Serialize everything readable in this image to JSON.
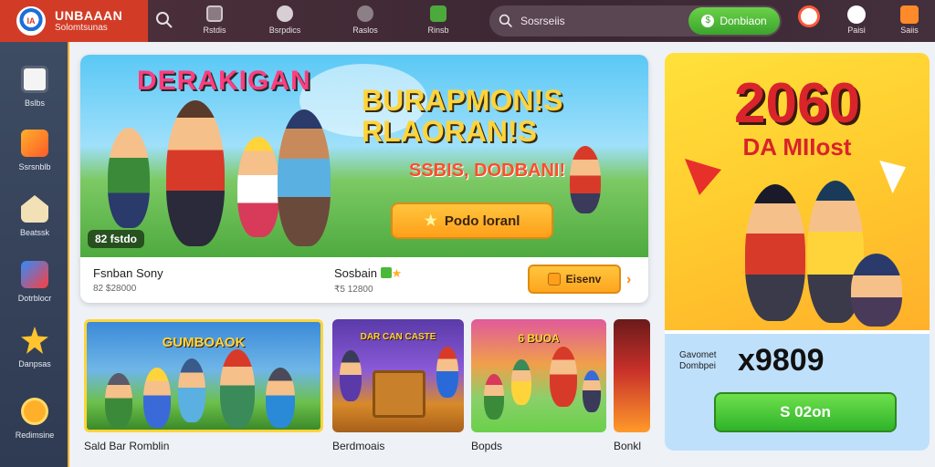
{
  "brand": {
    "logo_text": "IA",
    "title": "UNBAAAN",
    "subtitle": "Solomtsunas"
  },
  "topnav": [
    {
      "label": "Rstdis",
      "color": "#8a7a82"
    },
    {
      "label": "Bsrpdics",
      "color": "#d7cfd3"
    },
    {
      "label": "Raslos",
      "color": "#8d7f86"
    },
    {
      "label": "Rinsb",
      "color": "#4caa3c"
    }
  ],
  "search": {
    "placeholder": "Sosrseiis",
    "button_label": "Donbiaon"
  },
  "top_right": [
    {
      "label": "",
      "color": "#ff5a3c"
    },
    {
      "label": "Paisi",
      "color": "#ffffff"
    },
    {
      "label": "Saiis",
      "color": "#ff8a2a"
    }
  ],
  "sidebar": [
    {
      "label": "Bslbs",
      "color": "#f4f4f4"
    },
    {
      "label": "Ssrsnblb",
      "color": "#ff7a2a"
    },
    {
      "label": "Beatssk",
      "color": "#f2e0b6"
    },
    {
      "label": "Dotrblocr",
      "color": "#2f8cff"
    },
    {
      "label": "Danpsas",
      "color": "#ffc42e"
    },
    {
      "label": "Redimsine",
      "color": "#ffb02a"
    }
  ],
  "hero": {
    "tag": "DERAKIGAN",
    "title_line1": "BURAPMON!S",
    "title_line2": "RLAORAN!S",
    "subtitle": "SSBIS, DODBANI!",
    "cta_label": "Podo loranl",
    "badge": "82 fstdo",
    "footer": {
      "left_title": "Fsnban Sony",
      "left_sub": "82 $28000",
      "mid_title": "Sosbain",
      "mid_sub": "₹5 12800",
      "button_label": "Eisenv"
    }
  },
  "cards": [
    {
      "title": "Sald Bar Romblin",
      "art_label": "GUMBOAOK",
      "colors": [
        "#3a8ad8",
        "#6cc04a"
      ]
    },
    {
      "title": "Berdmoais",
      "art_label": "DAR CAN CASTE",
      "colors": [
        "#5a3aa8",
        "#d88a2a"
      ]
    },
    {
      "title": "Bopds",
      "art_label": "6 BUOA",
      "colors": [
        "#e05a9a",
        "#6ad04a"
      ]
    },
    {
      "title": "Bonkl",
      "art_label": "",
      "colors": [
        "#c8302a",
        "#ff9a2a"
      ]
    }
  ],
  "promo": {
    "number": "2060",
    "subtitle": "DA MIIost",
    "label": "Gavomet Dombpei",
    "amount": "x9809",
    "button_label": "S 02on"
  }
}
